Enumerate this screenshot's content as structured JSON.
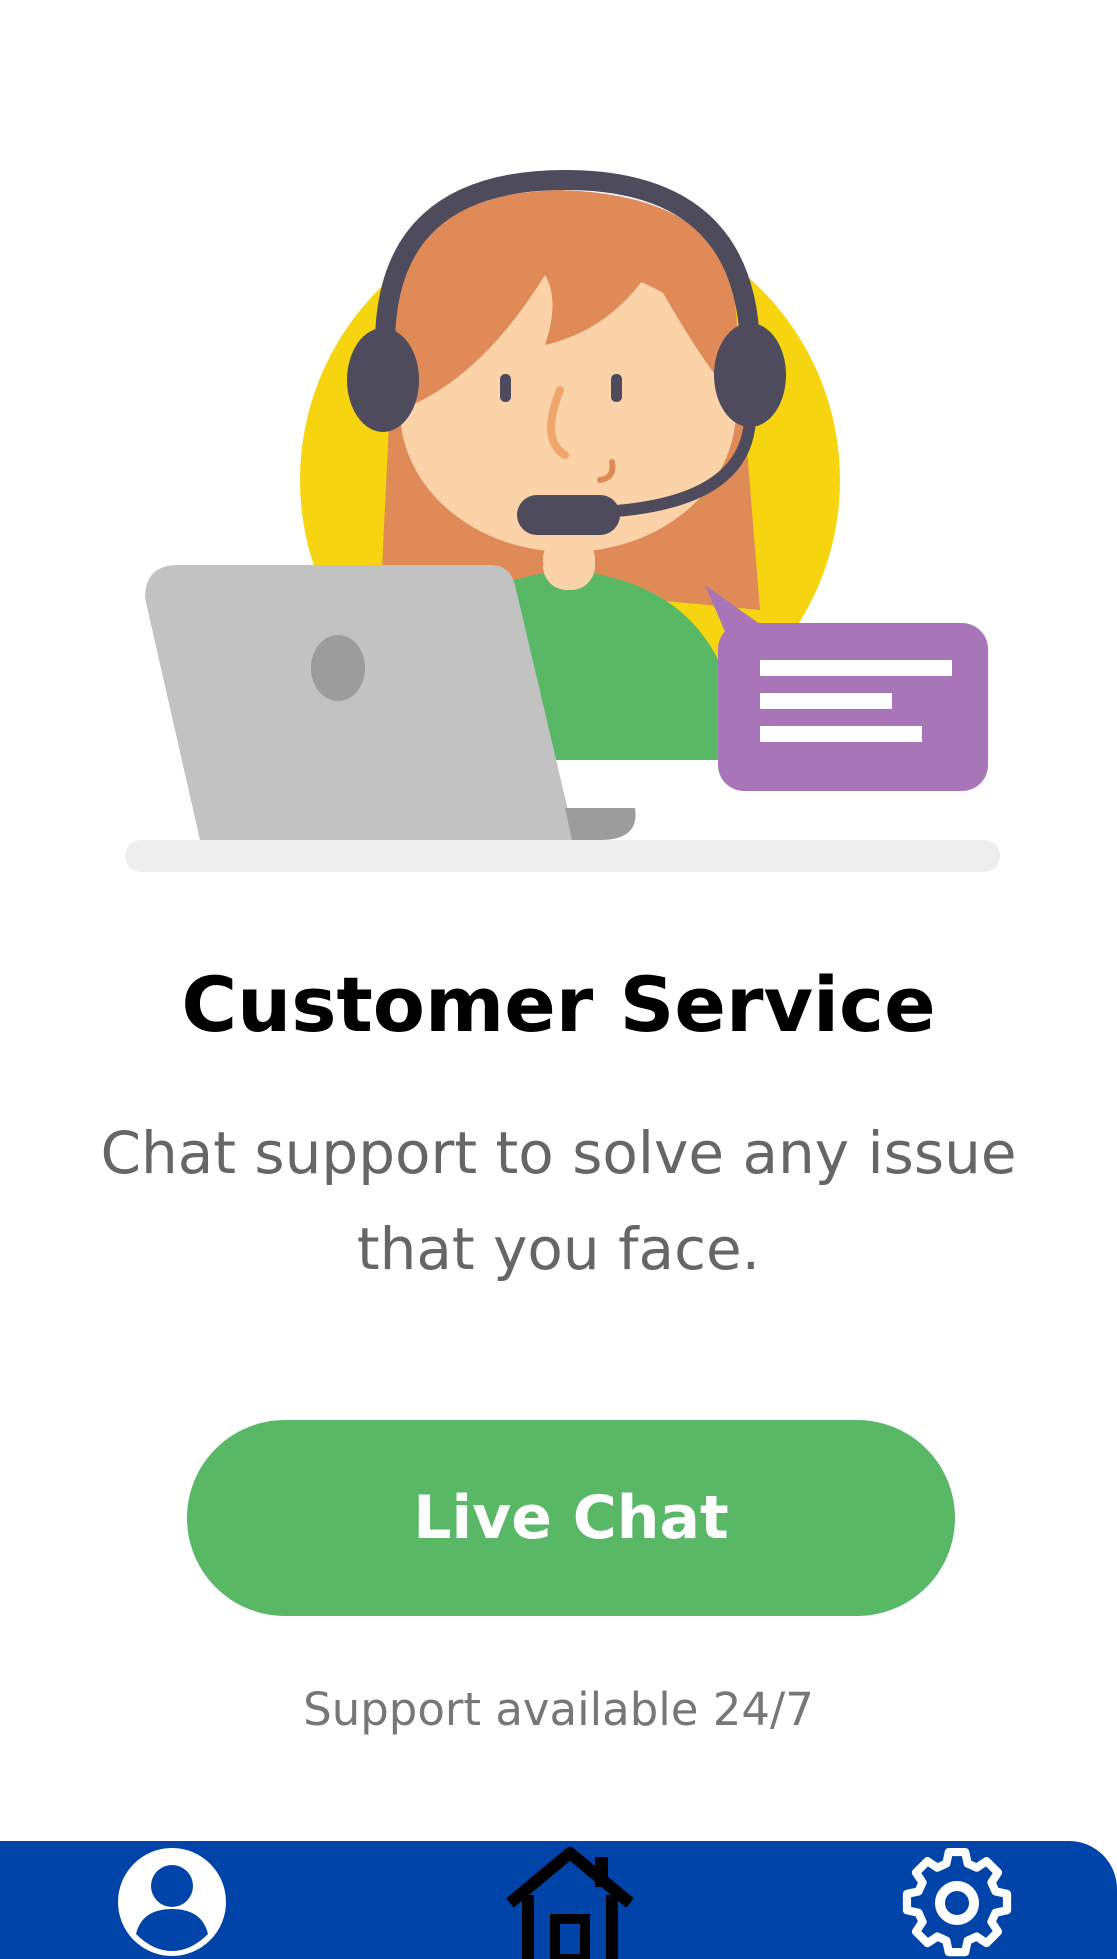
{
  "content": {
    "title": "Customer Service",
    "subtitle": "Chat support to solve any issue that you face.",
    "primary_button_label": "Live Chat",
    "availability_note": "Support available 24/7"
  },
  "illustration": {
    "subject": "customer-support-agent-with-headset-and-laptop",
    "colors": {
      "sun_circle": "#f6d40f",
      "hair": "#e08a57",
      "skin": "#fcd3a9",
      "headset": "#4e4b5c",
      "shirt": "#58b866",
      "laptop": "#c2c2c2",
      "chat_bubble": "#a975b9",
      "desk": "#eeeeee"
    }
  },
  "bottom_nav": {
    "background": "#0044aa",
    "items": [
      {
        "icon": "user-profile-icon"
      },
      {
        "icon": "home-icon"
      },
      {
        "icon": "gear-icon"
      }
    ]
  },
  "colors": {
    "accent": "#58b866",
    "title": "#000000",
    "body_text": "#666666",
    "note_text": "#777777"
  }
}
